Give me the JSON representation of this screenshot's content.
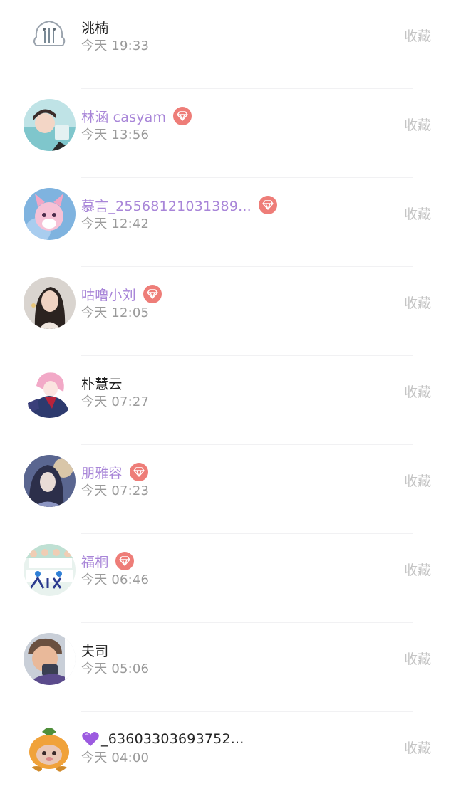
{
  "items": [
    {
      "name": "洮楠",
      "time": "今天 19:33",
      "vip": false,
      "action": "收藏",
      "avatar": "avatar-cartoon-logo"
    },
    {
      "name": "林涵 casyam",
      "time": "今天 13:56",
      "vip": true,
      "action": "收藏",
      "avatar": "avatar-girl-photo"
    },
    {
      "name": "慕言_25568121031389...",
      "time": "今天 12:42",
      "vip": true,
      "action": "收藏",
      "avatar": "avatar-pink-fox"
    },
    {
      "name": "咕噜小刘",
      "time": "今天 12:05",
      "vip": true,
      "action": "收藏",
      "avatar": "avatar-woman-photo"
    },
    {
      "name": "朴慧云",
      "time": "今天 07:27",
      "vip": false,
      "action": "收藏",
      "avatar": "avatar-anime-pink-hair"
    },
    {
      "name": "朋雅容",
      "time": "今天 07:23",
      "vip": true,
      "action": "收藏",
      "avatar": "avatar-anime-dark"
    },
    {
      "name": "福桐",
      "time": "今天 06:46",
      "vip": true,
      "action": "收藏",
      "avatar": "avatar-group-photo"
    },
    {
      "name": "夫司",
      "time": "今天 05:06",
      "vip": false,
      "action": "收藏",
      "avatar": "avatar-child-photo"
    },
    {
      "name": "_63603303693752...",
      "time": "今天 04:00",
      "vip": false,
      "action": "收藏",
      "avatar": "avatar-fruit-character",
      "name_prefix_icon": "purple-heart-icon"
    }
  ],
  "colors": {
    "vip_name": "#a885d8",
    "normal_name": "#222222",
    "time": "#9a9a9a",
    "action": "#c4c4c4",
    "vip_badge": "#ee7d78",
    "divider": "#f1f1f3"
  }
}
